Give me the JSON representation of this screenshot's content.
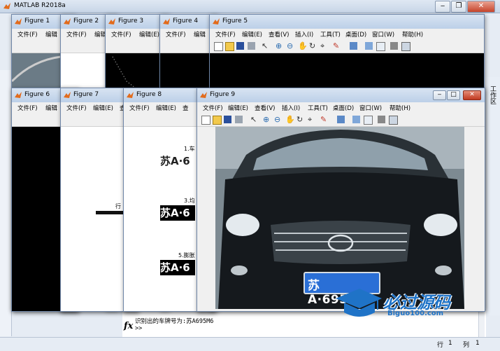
{
  "app": {
    "title": "MATLAB R2018a"
  },
  "figures": [
    {
      "title": "Figure 1"
    },
    {
      "title": "Figure 2"
    },
    {
      "title": "Figure 3"
    },
    {
      "title": "Figure 4"
    },
    {
      "title": "Figure 5"
    },
    {
      "title": "Figure 6"
    },
    {
      "title": "Figure 7"
    },
    {
      "title": "Figure 8"
    },
    {
      "title": "Figure 9"
    }
  ],
  "menu": {
    "file": "文件(F)",
    "edit": "编辑(E)",
    "view": "查看(V)",
    "insert": "插入(I)",
    "tools": "工具(T)",
    "desktop": "桌面(D)",
    "window": "窗口(W)",
    "help": "帮助(H)",
    "edit_short": "编辑",
    "view_short": "查"
  },
  "figure8": {
    "label1": "1.车",
    "label3": "3.均",
    "label5": "5.膨胀",
    "plate_text": "苏A·6"
  },
  "figure7": {
    "label": "行"
  },
  "plate": {
    "text": "苏A·695M6",
    "color": "#2a6fd6"
  },
  "command": {
    "output": "识别出的车牌号为:苏A695M6",
    "prompt": ">>",
    "fx": "fx"
  },
  "status": {
    "row_label": "行",
    "row": "1",
    "col_label": "列",
    "col": "1"
  },
  "side_panel": {
    "label": "工作区"
  },
  "watermark": {
    "brand": "必过源码",
    "url": "Biguo100.com"
  },
  "colors": {
    "accent": "#1f73c7",
    "titlebar": "#c7d5e7"
  }
}
